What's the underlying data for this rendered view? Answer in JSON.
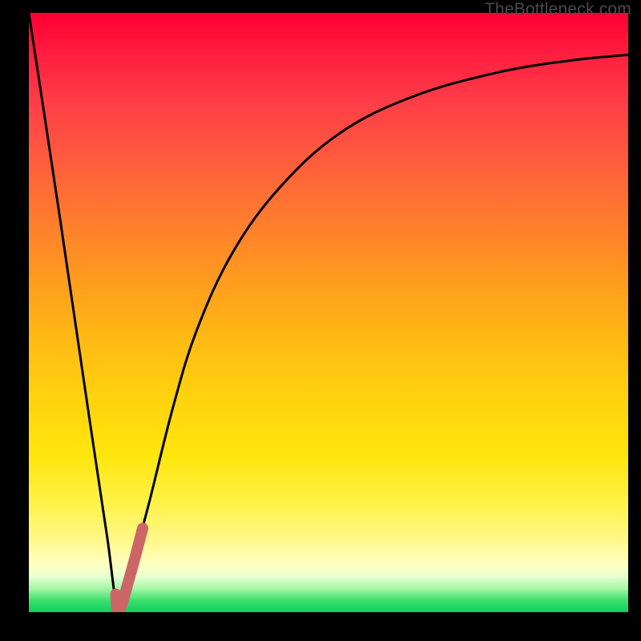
{
  "watermark": {
    "text": "TheBottleneck.com"
  },
  "chart_data": {
    "type": "line",
    "title": "",
    "xlabel": "",
    "ylabel": "",
    "xlim": [
      0,
      100
    ],
    "ylim": [
      0,
      100
    ],
    "grid": false,
    "legend": false,
    "series": [
      {
        "name": "bottleneck-curve",
        "x": [
          0,
          5,
          10,
          13,
          15,
          17,
          20,
          24,
          28,
          34,
          42,
          52,
          64,
          78,
          90,
          100
        ],
        "y": [
          100,
          67,
          33,
          13,
          0,
          7,
          18,
          34,
          47,
          60,
          71,
          80,
          86,
          90,
          92,
          93
        ],
        "_comment": "y is bottleneck percentage (vertical position, 0 at bottom). Sharp V near x≈15 then asymptotic rise."
      },
      {
        "name": "highlight-segment",
        "x": [
          14.5,
          15.0,
          17.0,
          19.0
        ],
        "y": [
          3.0,
          0.0,
          6.5,
          14.0
        ],
        "_comment": "Thick salmon J-shaped marker near the minimum."
      }
    ],
    "background_gradient": {
      "top": "#ff0033",
      "mid": "#ffd20e",
      "bottom": "#0ecf63"
    }
  }
}
